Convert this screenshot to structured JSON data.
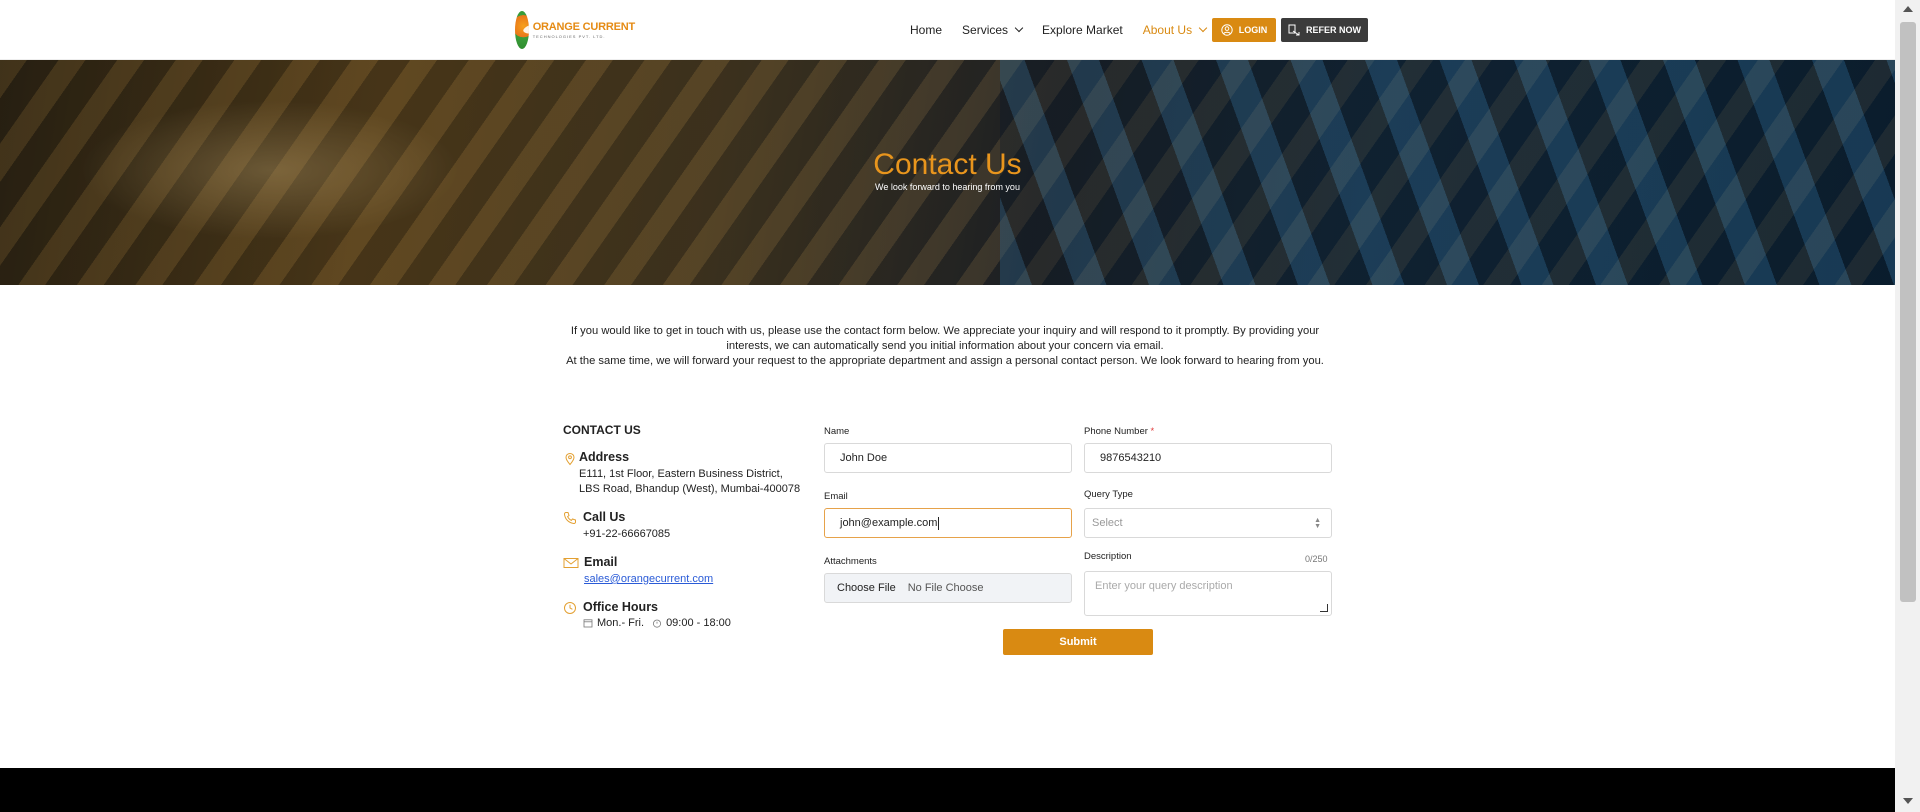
{
  "brand": {
    "line1": "ORANGE CURRENT",
    "line2": "TECHNOLOGIES PVT. LTD."
  },
  "nav": {
    "items": [
      "Home",
      "Services",
      "Explore Market",
      "About Us"
    ],
    "login": "LOGIN",
    "refer": "REFER NOW"
  },
  "hero": {
    "title": "Contact Us",
    "subtitle": "We look forward to hearing from you"
  },
  "intro": {
    "p1": "If you would like to get in touch with us, please use the contact form below. We appreciate your inquiry and will respond to it promptly. By providing your interests, we can automatically send you initial information about your concern via email.",
    "p2": "At the same time, we will forward your request to the appropriate department and assign a personal contact person. We look forward to hearing from you."
  },
  "contact": {
    "title": "CONTACT US",
    "address_label": "Address",
    "address": "E111, 1st Floor, Eastern Business District, LBS Road, Bhandup (West), Mumbai-400078",
    "call_label": "Call Us",
    "phone": "+91-22-66667085",
    "email_label": "Email",
    "email": "sales@orangecurrent.com",
    "hours_label": "Office Hours",
    "days": "Mon.- Fri.",
    "time": "09:00 - 18:00"
  },
  "form": {
    "name_label": "Name",
    "name_value": "John Doe",
    "phone_label": "Phone Number",
    "phone_required": "*",
    "phone_value": "9876543210",
    "email_label": "Email",
    "email_value": "john@example.com",
    "query_label": "Query Type",
    "query_value": "Select",
    "attach_label": "Attachments",
    "choose_file": "Choose File",
    "no_file": "No File Choose",
    "desc_label": "Description",
    "desc_counter": "0/250",
    "desc_placeholder": "Enter your query description",
    "submit": "Submit"
  },
  "colors": {
    "accent": "#d98a12",
    "dark_button": "#3b3b3b",
    "footer": "#000000",
    "link": "#2a5bd7"
  }
}
